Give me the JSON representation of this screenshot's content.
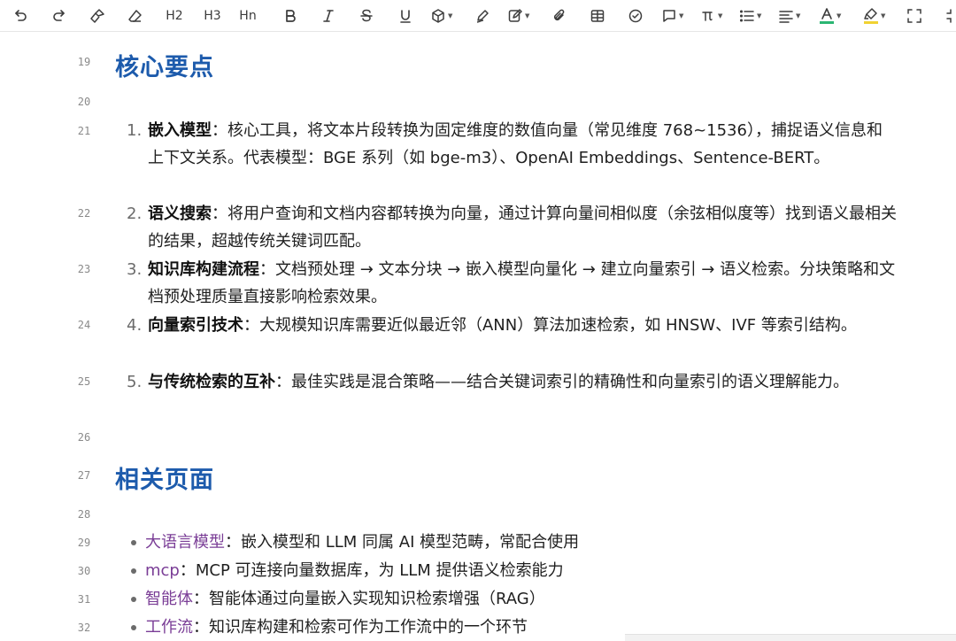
{
  "toolbar": {
    "h2": "H2",
    "h3": "H3",
    "hn": "Hn",
    "text_color_accent": "#2bb673",
    "highlight_accent": "#f1d232"
  },
  "editor": {
    "heading1": {
      "line": "19",
      "text": "核心要点"
    },
    "blank1": "20",
    "items": [
      {
        "line": "21",
        "num": "1.",
        "term": "嵌入模型",
        "text": "：核心工具，将文本片段转换为固定维度的数值向量（常见维度 768~1536），捕捉语义信息和上下文关系。代表模型：BGE 系列（如 bge-m3）、OpenAI Embeddings、Sentence-BERT。"
      },
      {
        "line": "22",
        "num": "2.",
        "term": "语义搜索",
        "text": "：将用户查询和文档内容都转换为向量，通过计算向量间相似度（余弦相似度等）找到语义最相关的结果，超越传统关键词匹配。"
      },
      {
        "line": "23",
        "num": "3.",
        "term": "知识库构建流程",
        "text": "：文档预处理 → 文本分块 → 嵌入模型向量化 → 建立向量索引 → 语义检索。分块策略和文档预处理质量直接影响检索效果。"
      },
      {
        "line": "24",
        "num": "4.",
        "term": "向量索引技术",
        "text": "：大规模知识库需要近似最近邻（ANN）算法加速检索，如 HNSW、IVF 等索引结构。"
      },
      {
        "line": "25",
        "num": "5.",
        "term": "与传统检索的互补",
        "text": "：最佳实践是混合策略——结合关键词索引的精确性和向量索引的语义理解能力。"
      }
    ],
    "blank2": "26",
    "heading2": {
      "line": "27",
      "text": "相关页面"
    },
    "blank3": "28",
    "related": [
      {
        "line": "29",
        "link": "大语言模型",
        "text": "：嵌入模型和 LLM 同属 AI 模型范畴，常配合使用"
      },
      {
        "line": "30",
        "link": "mcp",
        "text": "：MCP 可连接向量数据库，为 LLM 提供语义检索能力"
      },
      {
        "line": "31",
        "link": "智能体",
        "text": "：智能体通过向量嵌入实现知识检索增强（RAG）"
      },
      {
        "line": "32",
        "link": "工作流",
        "text": "：知识库构建和检索可作为工作流中的一个环节"
      }
    ]
  }
}
